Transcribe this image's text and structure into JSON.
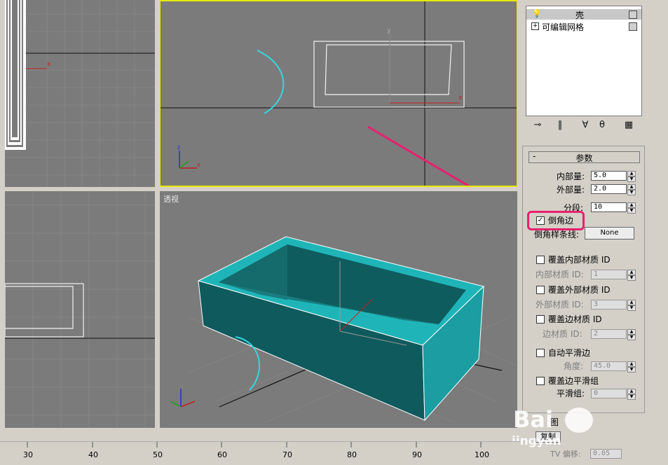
{
  "viewports": {
    "perspective_label": "透视",
    "top_axis": {
      "x": "x",
      "y": "y",
      "z": "z"
    }
  },
  "modifier_stack": {
    "items": [
      {
        "label": "壳",
        "icon": "lightbulb-icon"
      },
      {
        "label": "可编辑网格",
        "icon": "plus-expand-icon"
      }
    ]
  },
  "stack_toolbar": [
    "pin-stack-icon",
    "show-end-result-icon",
    "make-unique-icon",
    "remove-modifier-icon",
    "configure-modifier-sets-icon"
  ],
  "parameters": {
    "title": "参数",
    "collapse": "-",
    "inner_amount": {
      "label": "内部量:",
      "value": "5.0"
    },
    "outer_amount": {
      "label": "外部量:",
      "value": "2.0"
    },
    "segments": {
      "label": "分段:",
      "value": "10"
    },
    "bevel_edges": {
      "label": "倒角边",
      "checked": true,
      "check": "✓"
    },
    "bevel_spline": {
      "label": "倒角样条线:",
      "button": "None"
    },
    "override_inner_mat": {
      "label": "覆盖内部材质 ID",
      "checked": false
    },
    "inner_mat_id": {
      "label": "内部材质 ID:",
      "value": "1"
    },
    "override_outer_mat": {
      "label": "覆盖外部材质 ID",
      "checked": false
    },
    "outer_mat_id": {
      "label": "外部材质 ID:",
      "value": "3"
    },
    "override_edge_mat": {
      "label": "覆盖边材质 ID",
      "checked": false
    },
    "edge_mat_id": {
      "label": "边材质 ID:",
      "value": "2"
    },
    "auto_smooth": {
      "label": "自动平滑边",
      "checked": false
    },
    "angle": {
      "label": "角度:",
      "value": "45.0"
    },
    "override_smooth_group": {
      "label": "覆盖边平滑组",
      "checked": false
    },
    "smooth_group": {
      "label": "平滑组:",
      "value": "0"
    },
    "edge_mapping_partial": "图",
    "copy_label": "复制",
    "tv_offset": {
      "label": "TV 偏移:",
      "value": "0.05"
    }
  },
  "ruler": {
    "ticks": [
      "30",
      "40",
      "50",
      "60",
      "70",
      "80",
      "90",
      "100"
    ]
  },
  "watermark": {
    "brand": "Bai",
    "site": "jingyan"
  },
  "colors": {
    "viewport_bg": "#7b7b7b",
    "active_border": "#e8e800",
    "shell": "#1fb5b8",
    "annotation": "#e8206e"
  }
}
